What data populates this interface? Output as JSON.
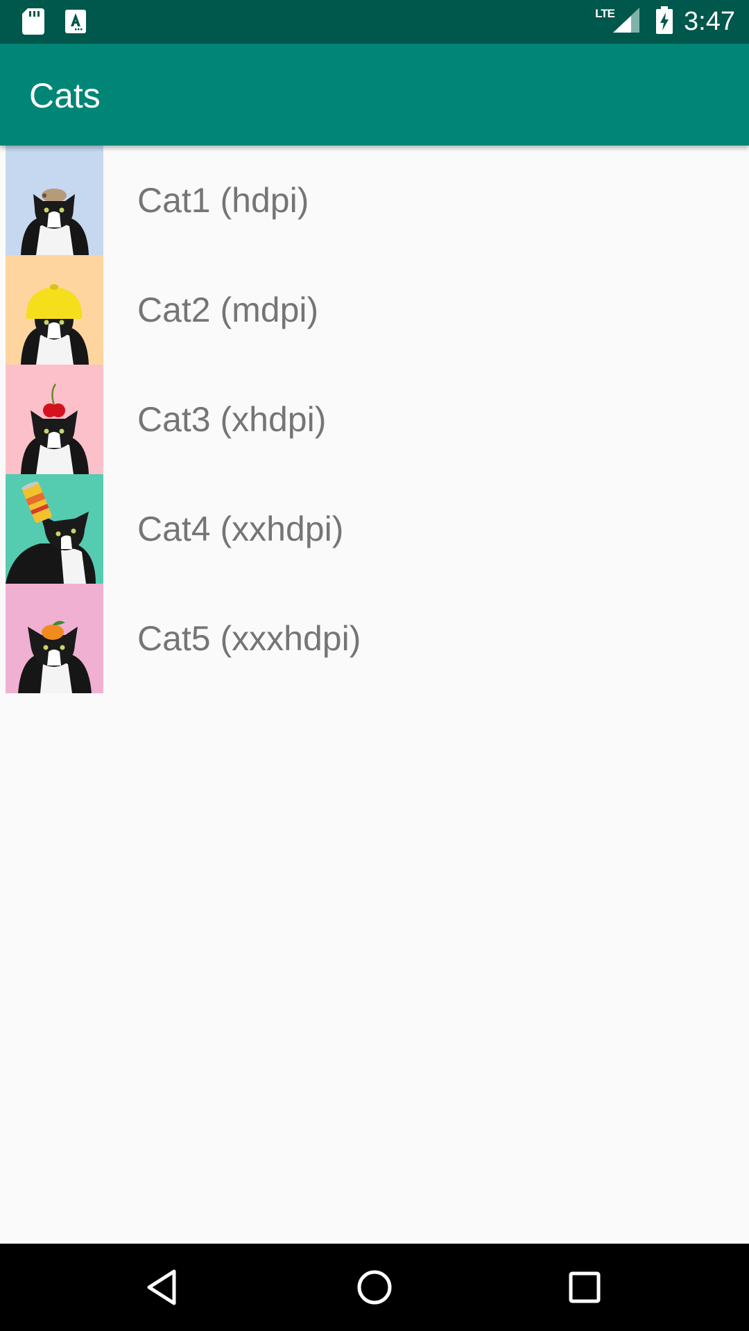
{
  "status_bar": {
    "left_icons": [
      "sd-card-icon",
      "app-notification-icon"
    ],
    "network_label": "LTE",
    "time": "3:47",
    "colors": {
      "background": "#00574b"
    }
  },
  "app_bar": {
    "title": "Cats",
    "colors": {
      "background": "#008577"
    }
  },
  "list": {
    "items": [
      {
        "label": "Cat1 (hdpi)",
        "bg_color": "#c5d8ef",
        "hat": "hedgehog"
      },
      {
        "label": "Cat2 (mdpi)",
        "bg_color": "#fed49f",
        "hat": "lemon"
      },
      {
        "label": "Cat3 (xhdpi)",
        "bg_color": "#fcc0cb",
        "hat": "cherry"
      },
      {
        "label": "Cat4 (xxhdpi)",
        "bg_color": "#55cbb0",
        "hat": "can"
      },
      {
        "label": "Cat5 (xxxhdpi)",
        "bg_color": "#f0b0d2",
        "hat": "orange"
      }
    ]
  },
  "nav_bar": {
    "buttons": [
      "back-icon",
      "home-icon",
      "recents-icon"
    ]
  }
}
